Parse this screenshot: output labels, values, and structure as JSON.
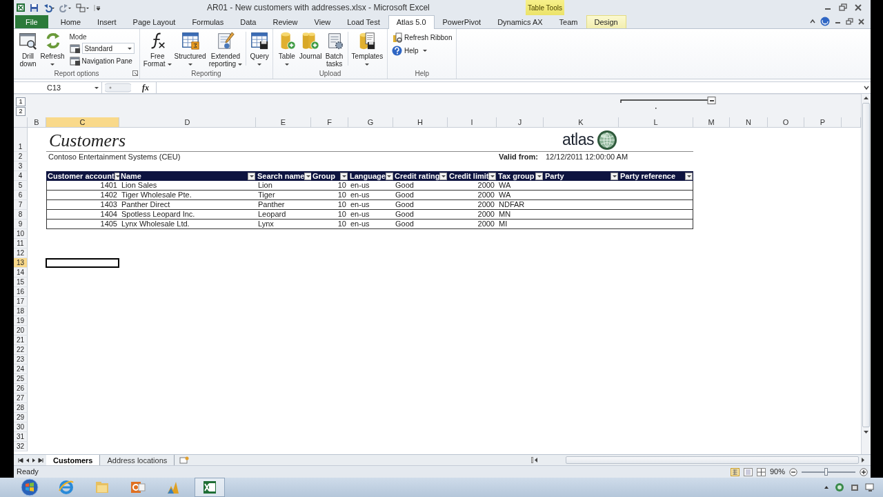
{
  "window": {
    "title": "AR01 - New customers with addresses.xlsx - Microsoft Excel",
    "context_group": "Table Tools"
  },
  "ribbon_tabs": [
    {
      "label": "File",
      "kind": "file",
      "selected": false
    },
    {
      "label": "Home",
      "kind": "tab",
      "selected": false
    },
    {
      "label": "Insert",
      "kind": "tab",
      "selected": false
    },
    {
      "label": "Page Layout",
      "kind": "tab",
      "selected": false
    },
    {
      "label": "Formulas",
      "kind": "tab",
      "selected": false
    },
    {
      "label": "Data",
      "kind": "tab",
      "selected": false
    },
    {
      "label": "Review",
      "kind": "tab",
      "selected": false
    },
    {
      "label": "View",
      "kind": "tab",
      "selected": false
    },
    {
      "label": "Load Test",
      "kind": "tab",
      "selected": false
    },
    {
      "label": "Atlas 5.0",
      "kind": "tab",
      "selected": true
    },
    {
      "label": "PowerPivot",
      "kind": "tab",
      "selected": false
    },
    {
      "label": "Dynamics AX",
      "kind": "tab",
      "selected": false
    },
    {
      "label": "Team",
      "kind": "tab",
      "selected": false
    },
    {
      "label": "Design",
      "kind": "contextual",
      "selected": false
    }
  ],
  "ribbon_groups": [
    {
      "label": "Report options",
      "launcher": true,
      "items": [
        {
          "kind": "large",
          "lines": [
            "Drill",
            "down"
          ]
        },
        {
          "kind": "large",
          "lines": [
            "Refresh"
          ],
          "dropdown": true
        },
        {
          "kind": "stack",
          "rows": [
            {
              "kind": "caption",
              "label": "Mode"
            },
            {
              "kind": "combo",
              "value": "Standard"
            },
            {
              "kind": "button",
              "label": "Navigation Pane"
            }
          ]
        }
      ]
    },
    {
      "label": "Reporting",
      "items": [
        {
          "kind": "large",
          "lines": [
            "Free",
            "Format"
          ],
          "dropdown": true
        },
        {
          "kind": "large",
          "lines": [
            "Structured"
          ],
          "dropdown": true
        },
        {
          "kind": "large",
          "lines": [
            "Extended",
            "reporting"
          ],
          "dropdown": true
        },
        {
          "kind": "separator"
        },
        {
          "kind": "large",
          "lines": [
            "Query"
          ],
          "dropdown": true
        }
      ]
    },
    {
      "label": "Upload",
      "items": [
        {
          "kind": "large",
          "lines": [
            "Table"
          ],
          "dropdown": true
        },
        {
          "kind": "large",
          "lines": [
            "Journal"
          ]
        },
        {
          "kind": "large",
          "lines": [
            "Batch",
            "tasks"
          ]
        },
        {
          "kind": "separator"
        },
        {
          "kind": "large",
          "lines": [
            "Templates"
          ],
          "dropdown": true
        }
      ]
    },
    {
      "label": "Help",
      "items": [
        {
          "kind": "stack",
          "rows": [
            {
              "kind": "button",
              "label": "Refresh Ribbon"
            },
            {
              "kind": "button",
              "label": "Help",
              "dropdown": true
            }
          ]
        }
      ]
    }
  ],
  "formula_bar": {
    "name_box": "C13",
    "function_label": "fx"
  },
  "outline_levels": [
    "1",
    "2"
  ],
  "column_headers": [
    {
      "label": "B",
      "selected": false
    },
    {
      "label": "C",
      "selected": true
    },
    {
      "label": "D",
      "selected": false
    },
    {
      "label": "E",
      "selected": false
    },
    {
      "label": "F",
      "selected": false
    },
    {
      "label": "G",
      "selected": false
    },
    {
      "label": "H",
      "selected": false
    },
    {
      "label": "I",
      "selected": false
    },
    {
      "label": "J",
      "selected": false
    },
    {
      "label": "K",
      "selected": false
    },
    {
      "label": "L",
      "selected": false
    },
    {
      "label": "M",
      "selected": false
    },
    {
      "label": "N",
      "selected": false
    },
    {
      "label": "O",
      "selected": false
    },
    {
      "label": "P",
      "selected": false
    }
  ],
  "row_headers": [
    {
      "label": "1",
      "selected": false
    },
    {
      "label": "2",
      "selected": false
    },
    {
      "label": "3",
      "selected": false
    },
    {
      "label": "4",
      "selected": false
    },
    {
      "label": "5",
      "selected": false
    },
    {
      "label": "6",
      "selected": false
    },
    {
      "label": "7",
      "selected": false
    },
    {
      "label": "8",
      "selected": false
    },
    {
      "label": "9",
      "selected": false
    },
    {
      "label": "10",
      "selected": false
    },
    {
      "label": "11",
      "selected": false
    },
    {
      "label": "12",
      "selected": false
    },
    {
      "label": "13",
      "selected": true
    },
    {
      "label": "14",
      "selected": false
    },
    {
      "label": "15",
      "selected": false
    },
    {
      "label": "16",
      "selected": false
    },
    {
      "label": "17",
      "selected": false
    },
    {
      "label": "18",
      "selected": false
    },
    {
      "label": "19",
      "selected": false
    },
    {
      "label": "20",
      "selected": false
    },
    {
      "label": "21",
      "selected": false
    },
    {
      "label": "22",
      "selected": false
    },
    {
      "label": "23",
      "selected": false
    },
    {
      "label": "24",
      "selected": false
    },
    {
      "label": "25",
      "selected": false
    },
    {
      "label": "26",
      "selected": false
    },
    {
      "label": "27",
      "selected": false
    },
    {
      "label": "28",
      "selected": false
    },
    {
      "label": "29",
      "selected": false
    },
    {
      "label": "30",
      "selected": false
    },
    {
      "label": "31",
      "selected": false
    },
    {
      "label": "32",
      "selected": false
    }
  ],
  "sheet": {
    "title": "Customers",
    "company": "Contoso Entertainment Systems (CEU)",
    "logo_text": "atlas",
    "valid_from_label": "Valid from:",
    "valid_from": "12/12/2011 12:00:00 AM",
    "table": {
      "columns": [
        {
          "label": "Customer account",
          "numeric": true
        },
        {
          "label": "Name"
        },
        {
          "label": "Search name"
        },
        {
          "label": "Group",
          "numeric": true
        },
        {
          "label": "Language"
        },
        {
          "label": "Credit rating"
        },
        {
          "label": "Credit limit",
          "numeric": true
        },
        {
          "label": "Tax group"
        },
        {
          "label": "Party"
        },
        {
          "label": "Party reference"
        }
      ],
      "rows": [
        [
          "1401",
          "Lion Sales",
          "Lion",
          "10",
          "en-us",
          "Good",
          "2000",
          "WA"
        ],
        [
          "1402",
          "Tiger Wholesale Pte.",
          "Tiger",
          "10",
          "en-us",
          "Good",
          "2000",
          "WA"
        ],
        [
          "1403",
          "Panther Direct",
          "Panther",
          "10",
          "en-us",
          "Good",
          "2000",
          "NDFAR"
        ],
        [
          "1404",
          "Spotless Leopard Inc.",
          "Leopard",
          "10",
          "en-us",
          "Good",
          "2000",
          "MN"
        ],
        [
          "1405",
          "Lynx Wholesale Ltd.",
          "Lynx",
          "10",
          "en-us",
          "Good",
          "2000",
          "MI"
        ]
      ]
    }
  },
  "sheet_tabs": [
    {
      "label": "Customers",
      "selected": true
    },
    {
      "label": "Address locations",
      "selected": false
    }
  ],
  "status_bar": {
    "status": "Ready",
    "zoom": "90%",
    "zoom_slider": {
      "level": 0.45
    }
  }
}
